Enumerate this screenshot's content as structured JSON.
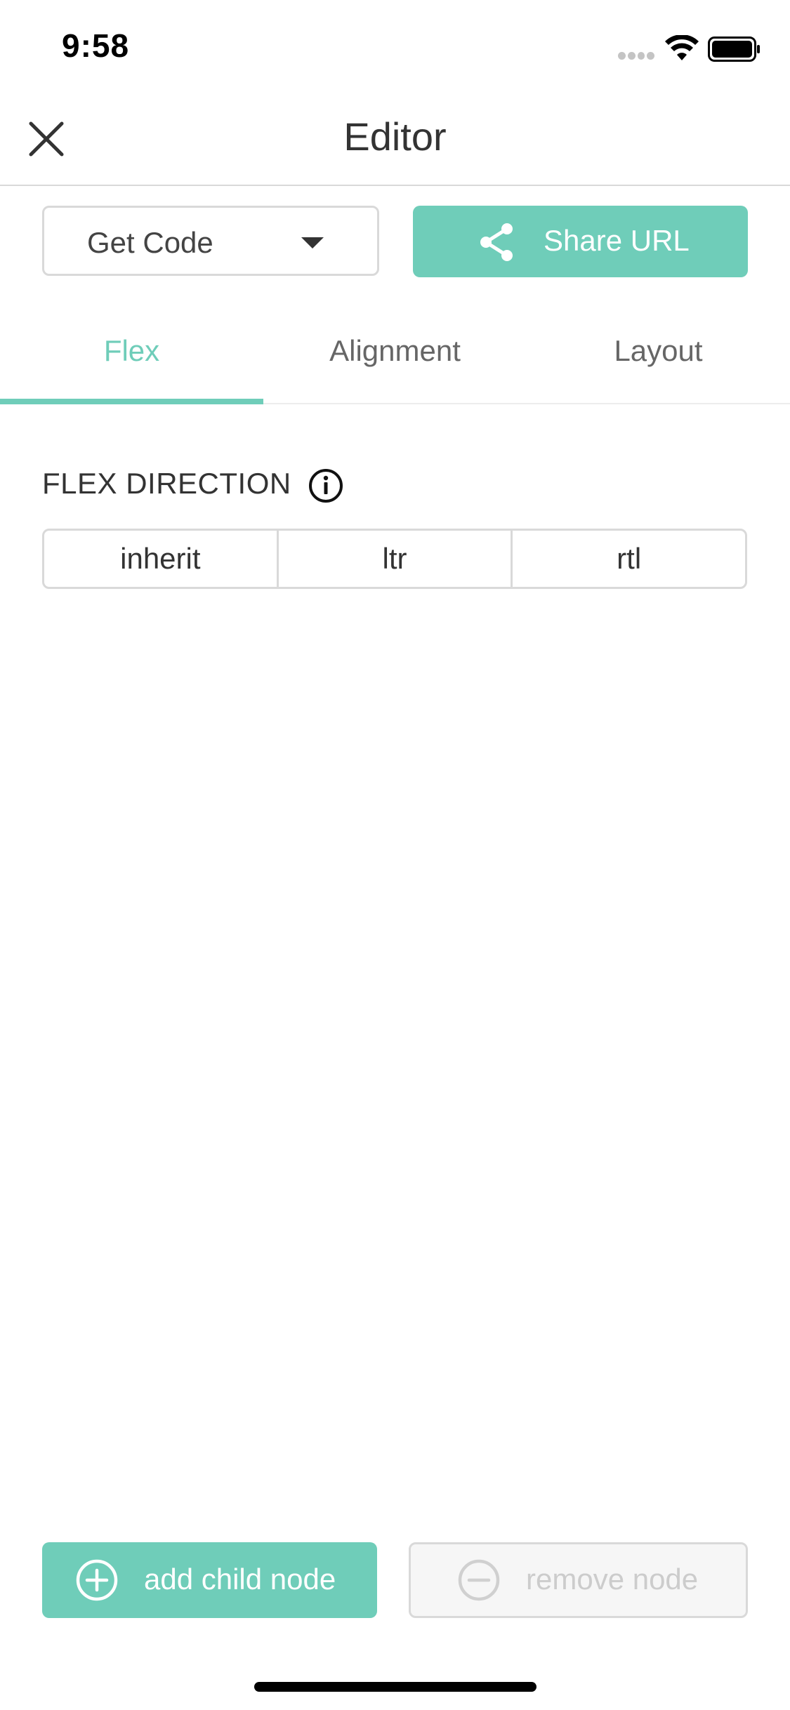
{
  "status_bar": {
    "time": "9:58",
    "signal_icon": "signal-dots-icon",
    "wifi_icon": "wifi-icon",
    "battery_icon": "battery-icon"
  },
  "header": {
    "title": "Editor",
    "close_icon": "close-icon"
  },
  "actions": {
    "get_code": {
      "label": "Get Code",
      "icon": "caret-down-icon"
    },
    "share": {
      "label": "Share URL",
      "icon": "share-icon"
    }
  },
  "tabs": [
    {
      "label": "Flex",
      "active": true
    },
    {
      "label": "Alignment",
      "active": false
    },
    {
      "label": "Layout",
      "active": false
    }
  ],
  "flex_direction": {
    "title": "FLEX DIRECTION",
    "info_icon": "info-icon",
    "options": [
      "inherit",
      "ltr",
      "rtl"
    ]
  },
  "bottom_actions": {
    "add": {
      "label": "add child node",
      "icon": "plus-circle-icon",
      "enabled": true
    },
    "remove": {
      "label": "remove node",
      "icon": "minus-circle-icon",
      "enabled": false
    }
  },
  "colors": {
    "accent": "#6fcdb9",
    "border": "#d9d9d9",
    "text": "#333333",
    "muted": "#666666",
    "disabled_text": "#cccccc"
  }
}
